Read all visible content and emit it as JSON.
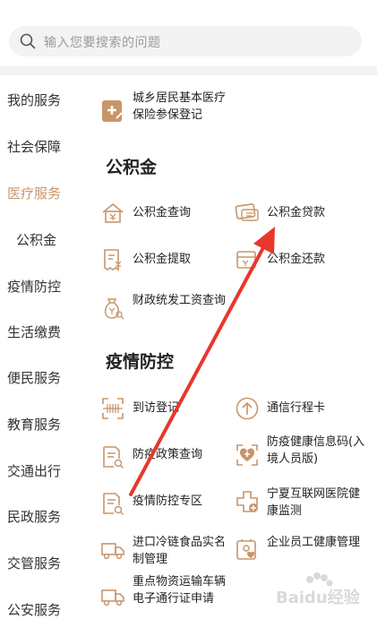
{
  "search": {
    "placeholder": "输入您要搜索的问题"
  },
  "sidebar": {
    "items": [
      {
        "label": "我的服务"
      },
      {
        "label": "社会保障"
      },
      {
        "label": "医疗服务"
      },
      {
        "label": "公积金"
      },
      {
        "label": "疫情防控"
      },
      {
        "label": "生活缴费"
      },
      {
        "label": "便民服务"
      },
      {
        "label": "教育服务"
      },
      {
        "label": "交通出行"
      },
      {
        "label": "民政服务"
      },
      {
        "label": "交管服务"
      },
      {
        "label": "公安服务"
      }
    ],
    "active_index": 2,
    "active_color": "#c8956a"
  },
  "medical": {
    "items": [
      {
        "label": "城乡居民基本医疗保险参保登记",
        "icon": "medical-plus-icon"
      }
    ]
  },
  "housing_fund": {
    "title": "公积金",
    "items": [
      {
        "label": "公积金查询",
        "icon": "house-yuan-icon"
      },
      {
        "label": "公积金贷款",
        "icon": "loan-card-icon"
      },
      {
        "label": "公积金提取",
        "icon": "receipt-yuan-icon"
      },
      {
        "label": "公积金还款",
        "icon": "repay-card-icon"
      },
      {
        "label": "财政统发工资查询",
        "icon": "money-bag-search-icon"
      }
    ]
  },
  "epidemic": {
    "title": "疫情防控",
    "items": [
      {
        "label": "到访登记",
        "icon": "scan-icon"
      },
      {
        "label": "通信行程卡",
        "icon": "arrow-up-circle-icon"
      },
      {
        "label": "防疫政策查询",
        "icon": "document-search-icon"
      },
      {
        "label": "防疫健康信息码(入境人员版)",
        "icon": "health-code-icon"
      },
      {
        "label": "疫情防控专区",
        "icon": "document-search-icon"
      },
      {
        "label": "宁夏互联网医院健康监测",
        "icon": "hospital-plus-icon"
      },
      {
        "label": "进口冷链食品实名制管理",
        "icon": "truck-icon"
      },
      {
        "label": "企业员工健康管理",
        "icon": "staff-health-icon"
      },
      {
        "label": "重点物资运输车辆电子通行证申请",
        "icon": "truck-icon"
      }
    ]
  },
  "overlay": {
    "arrow_color": "#e8372b",
    "watermark_text": "Baidu经验"
  },
  "icon_color": "#c8956a"
}
